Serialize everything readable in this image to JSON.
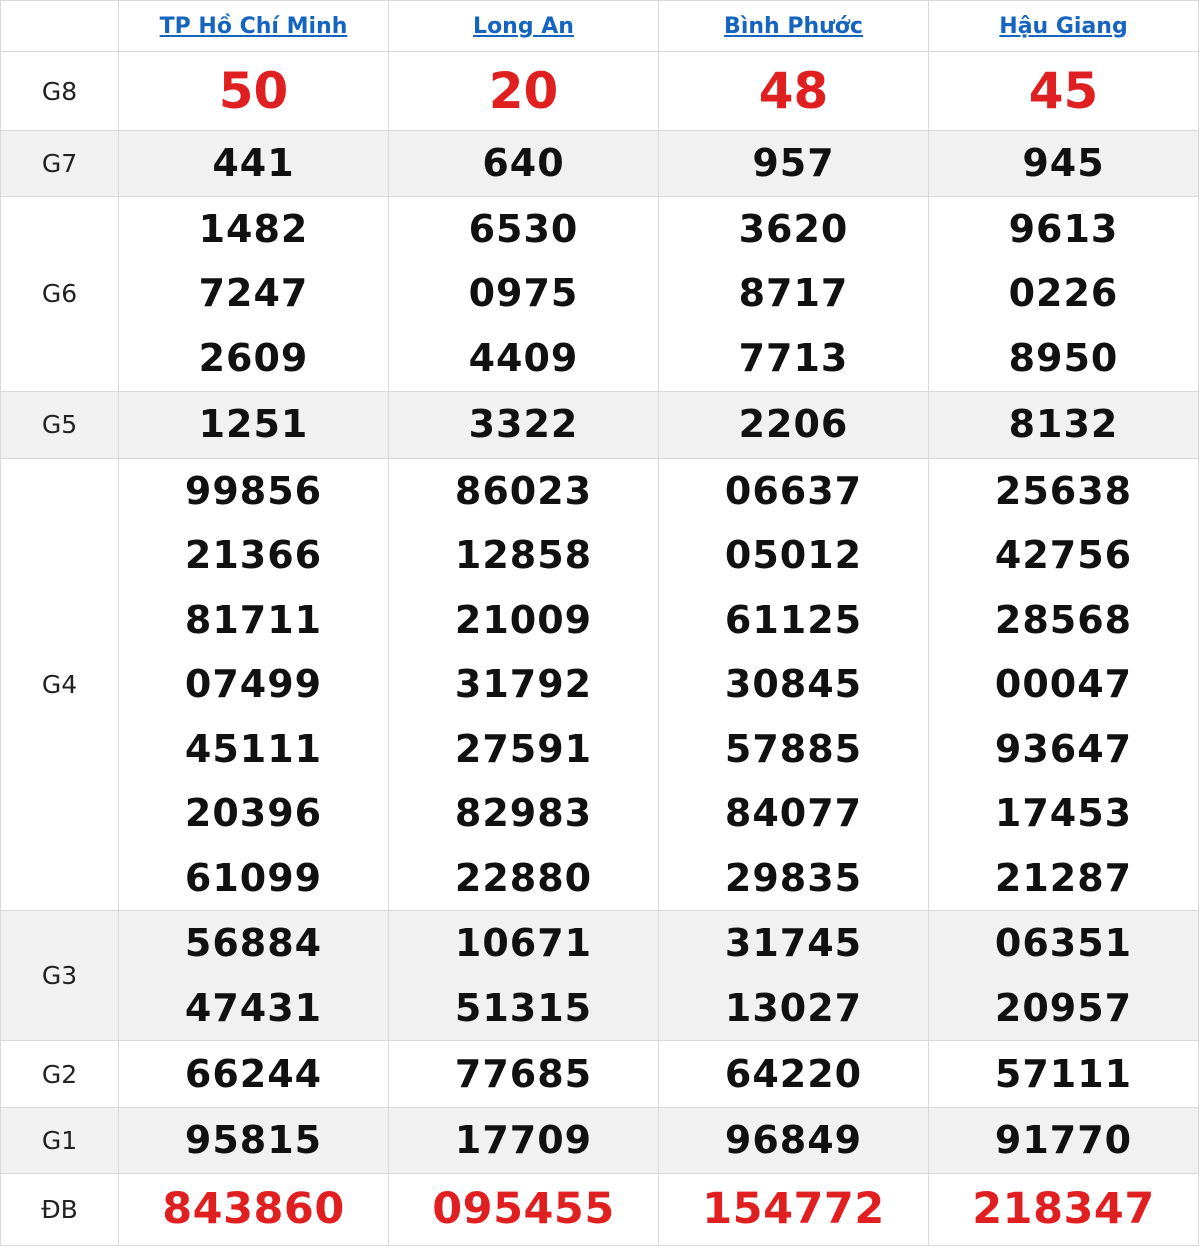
{
  "provinces": [
    {
      "name": "TP Hồ Chí Minh"
    },
    {
      "name": "Long An"
    },
    {
      "name": "Bình Phước"
    },
    {
      "name": "Hậu Giang"
    }
  ],
  "prize_labels": {
    "g8": "G8",
    "g7": "G7",
    "g6": "G6",
    "g5": "G5",
    "g4": "G4",
    "g3": "G3",
    "g2": "G2",
    "g1": "G1",
    "db": "ĐB"
  },
  "results": {
    "g8": [
      [
        "50"
      ],
      [
        "20"
      ],
      [
        "48"
      ],
      [
        "45"
      ]
    ],
    "g7": [
      [
        "441"
      ],
      [
        "640"
      ],
      [
        "957"
      ],
      [
        "945"
      ]
    ],
    "g6": [
      [
        "1482",
        "7247",
        "2609"
      ],
      [
        "6530",
        "0975",
        "4409"
      ],
      [
        "3620",
        "8717",
        "7713"
      ],
      [
        "9613",
        "0226",
        "8950"
      ]
    ],
    "g5": [
      [
        "1251"
      ],
      [
        "3322"
      ],
      [
        "2206"
      ],
      [
        "8132"
      ]
    ],
    "g4": [
      [
        "99856",
        "21366",
        "81711",
        "07499",
        "45111",
        "20396",
        "61099"
      ],
      [
        "86023",
        "12858",
        "21009",
        "31792",
        "27591",
        "82983",
        "22880"
      ],
      [
        "06637",
        "05012",
        "61125",
        "30845",
        "57885",
        "84077",
        "29835"
      ],
      [
        "25638",
        "42756",
        "28568",
        "00047",
        "93647",
        "17453",
        "21287"
      ]
    ],
    "g3": [
      [
        "56884",
        "47431"
      ],
      [
        "10671",
        "51315"
      ],
      [
        "31745",
        "13027"
      ],
      [
        "06351",
        "20957"
      ]
    ],
    "g2": [
      [
        "66244"
      ],
      [
        "77685"
      ],
      [
        "64220"
      ],
      [
        "57111"
      ]
    ],
    "g1": [
      [
        "95815"
      ],
      [
        "17709"
      ],
      [
        "96849"
      ],
      [
        "91770"
      ]
    ],
    "db": [
      [
        "843860"
      ],
      [
        "095455"
      ],
      [
        "154772"
      ],
      [
        "218347"
      ]
    ]
  },
  "colors": {
    "header_link": "#1565c0",
    "highlight_red": "#e02020",
    "number_text": "#111111",
    "row_shade": "#f1f1f1",
    "border": "#d9d9d9"
  }
}
